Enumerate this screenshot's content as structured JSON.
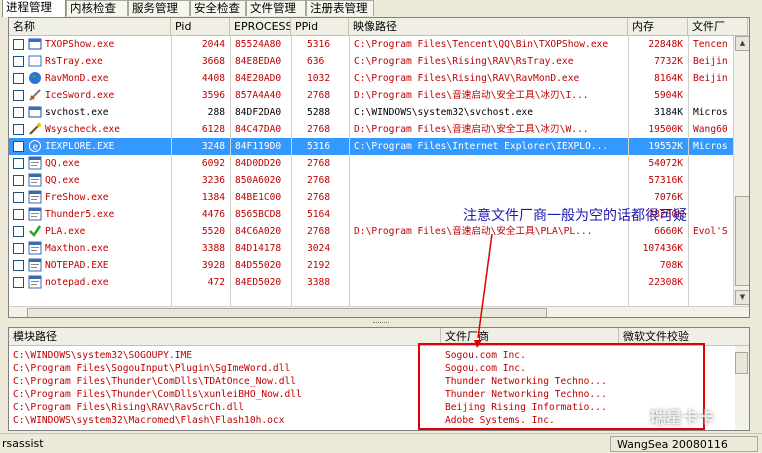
{
  "tabs": [
    "进程管理",
    "内核检查",
    "服务管理",
    "安全检查",
    "文件管理",
    "注册表管理"
  ],
  "process_table": {
    "headers": [
      "名称",
      "Pid",
      "EPROCESS",
      "PPid",
      "映像路径",
      "内存",
      "文件厂"
    ],
    "rows": [
      {
        "name": "TXOPShow.exe",
        "pid": "2044",
        "eprocess": "85524A80",
        "ppid": "5316",
        "path": "C:\\Program Files\\Tencent\\QQ\\Bin\\TXOPShow.exe",
        "mem": "22848K",
        "vendor": "Tencen",
        "color": "red",
        "icon": "window-icon"
      },
      {
        "name": "RsTray.exe",
        "pid": "3668",
        "eprocess": "84E8EDA0",
        "ppid": "636",
        "path": "C:\\Program Files\\Rising\\RAV\\RsTray.exe",
        "mem": "7732K",
        "vendor": "Beijin",
        "color": "red",
        "icon": "blank-window-icon"
      },
      {
        "name": "RavMonD.exe",
        "pid": "4408",
        "eprocess": "84E20AD0",
        "ppid": "1032",
        "path": "C:\\Program Files\\Rising\\RAV\\RavMonD.exe",
        "mem": "8164K",
        "vendor": "Beijin",
        "color": "red",
        "icon": "globe-icon"
      },
      {
        "name": "IceSword.exe",
        "pid": "3596",
        "eprocess": "857A4A40",
        "ppid": "2768",
        "path": "D:\\Program Files\\音速启动\\安全工具\\冰刃\\I...",
        "mem": "5904K",
        "vendor": "",
        "color": "red",
        "icon": "sword-icon"
      },
      {
        "name": "svchost.exe",
        "pid": "288",
        "eprocess": "84DF2DA0",
        "ppid": "5288",
        "path": "C:\\WINDOWS\\system32\\svchost.exe",
        "mem": "3184K",
        "vendor": "Micros",
        "color": "black",
        "icon": "window-icon"
      },
      {
        "name": "Wsyscheck.exe",
        "pid": "6128",
        "eprocess": "84C47DA0",
        "ppid": "2768",
        "path": "D:\\Program Files\\音速启动\\安全工具\\冰刃\\W...",
        "mem": "19500K",
        "vendor": "Wang60",
        "color": "red",
        "icon": "wand-icon"
      },
      {
        "name": "IEXPLORE.EXE",
        "pid": "3248",
        "eprocess": "84F119D0",
        "ppid": "5316",
        "path": "C:\\Program Files\\Internet Explorer\\IEXPLO...",
        "mem": "19552K",
        "vendor": "Micros",
        "color": "black",
        "icon": "ie-icon",
        "selected": true
      },
      {
        "name": "QQ.exe",
        "pid": "6092",
        "eprocess": "84D0DD20",
        "ppid": "2768",
        "path": "",
        "mem": "54072K",
        "vendor": "",
        "color": "red",
        "icon": "app-icon"
      },
      {
        "name": "QQ.exe",
        "pid": "3236",
        "eprocess": "850A6020",
        "ppid": "2768",
        "path": "",
        "mem": "57316K",
        "vendor": "",
        "color": "red",
        "icon": "app-icon"
      },
      {
        "name": "FreShow.exe",
        "pid": "1384",
        "eprocess": "84BE1C00",
        "ppid": "2768",
        "path": "",
        "mem": "7076K",
        "vendor": "",
        "color": "red",
        "icon": "app-icon"
      },
      {
        "name": "Thunder5.exe",
        "pid": "4476",
        "eprocess": "8565BCD8",
        "ppid": "5164",
        "path": "",
        "mem": "28280K",
        "vendor": "",
        "color": "red",
        "icon": "app-icon"
      },
      {
        "name": "PLA.exe",
        "pid": "5520",
        "eprocess": "84C6A020",
        "ppid": "2768",
        "path": "D:\\Program Files\\音速启动\\安全工具\\PLA\\PL...",
        "mem": "6660K",
        "vendor": "Evol'S",
        "color": "red",
        "icon": "check-icon"
      },
      {
        "name": "Maxthon.exe",
        "pid": "3388",
        "eprocess": "84D14178",
        "ppid": "3024",
        "path": "",
        "mem": "107436K",
        "vendor": "",
        "color": "red",
        "icon": "app-icon"
      },
      {
        "name": "NOTEPAD.EXE",
        "pid": "3928",
        "eprocess": "84D55020",
        "ppid": "2192",
        "path": "",
        "mem": "708K",
        "vendor": "",
        "color": "red",
        "icon": "app-icon"
      },
      {
        "name": "notepad.exe",
        "pid": "472",
        "eprocess": "84ED5020",
        "ppid": "3388",
        "path": "",
        "mem": "22308K",
        "vendor": "",
        "color": "red",
        "icon": "app-icon"
      }
    ]
  },
  "module_table": {
    "headers": [
      "模块路径",
      "文件厂商",
      "微软文件校验"
    ],
    "rows": [
      {
        "path": "C:\\WINDOWS\\system32\\SOGOUPY.IME",
        "vendor": "Sogou.com Inc."
      },
      {
        "path": "C:\\Program Files\\SogouInput\\Plugin\\SgImeWord.dll",
        "vendor": "Sogou.com Inc."
      },
      {
        "path": "C:\\Program Files\\Thunder\\ComDlls\\TDAtOnce_Now.dll",
        "vendor": "Thunder Networking Techno..."
      },
      {
        "path": "C:\\Program Files\\Thunder\\ComDlls\\xunleiBHO_Now.dll",
        "vendor": "Thunder Networking Techno..."
      },
      {
        "path": "C:\\Program Files\\Rising\\RAV\\RavScrCh.dll",
        "vendor": "Beijing Rising Informatio..."
      },
      {
        "path": "C:\\WINDOWS\\system32\\Macromed\\Flash\\Flash10h.ocx",
        "vendor": "Adobe Systems. Inc."
      }
    ]
  },
  "annotation": "注意文件厂商一般为空的话都很可疑",
  "status": {
    "left": "rsassist",
    "right": "WangSea 20080116"
  },
  "watermark": "瑞星卡卡",
  "colors": {
    "red_text": "#c00000",
    "selection": "#3399ff",
    "annotation": "#1b1bb0",
    "highlight_box": "#e00000"
  }
}
